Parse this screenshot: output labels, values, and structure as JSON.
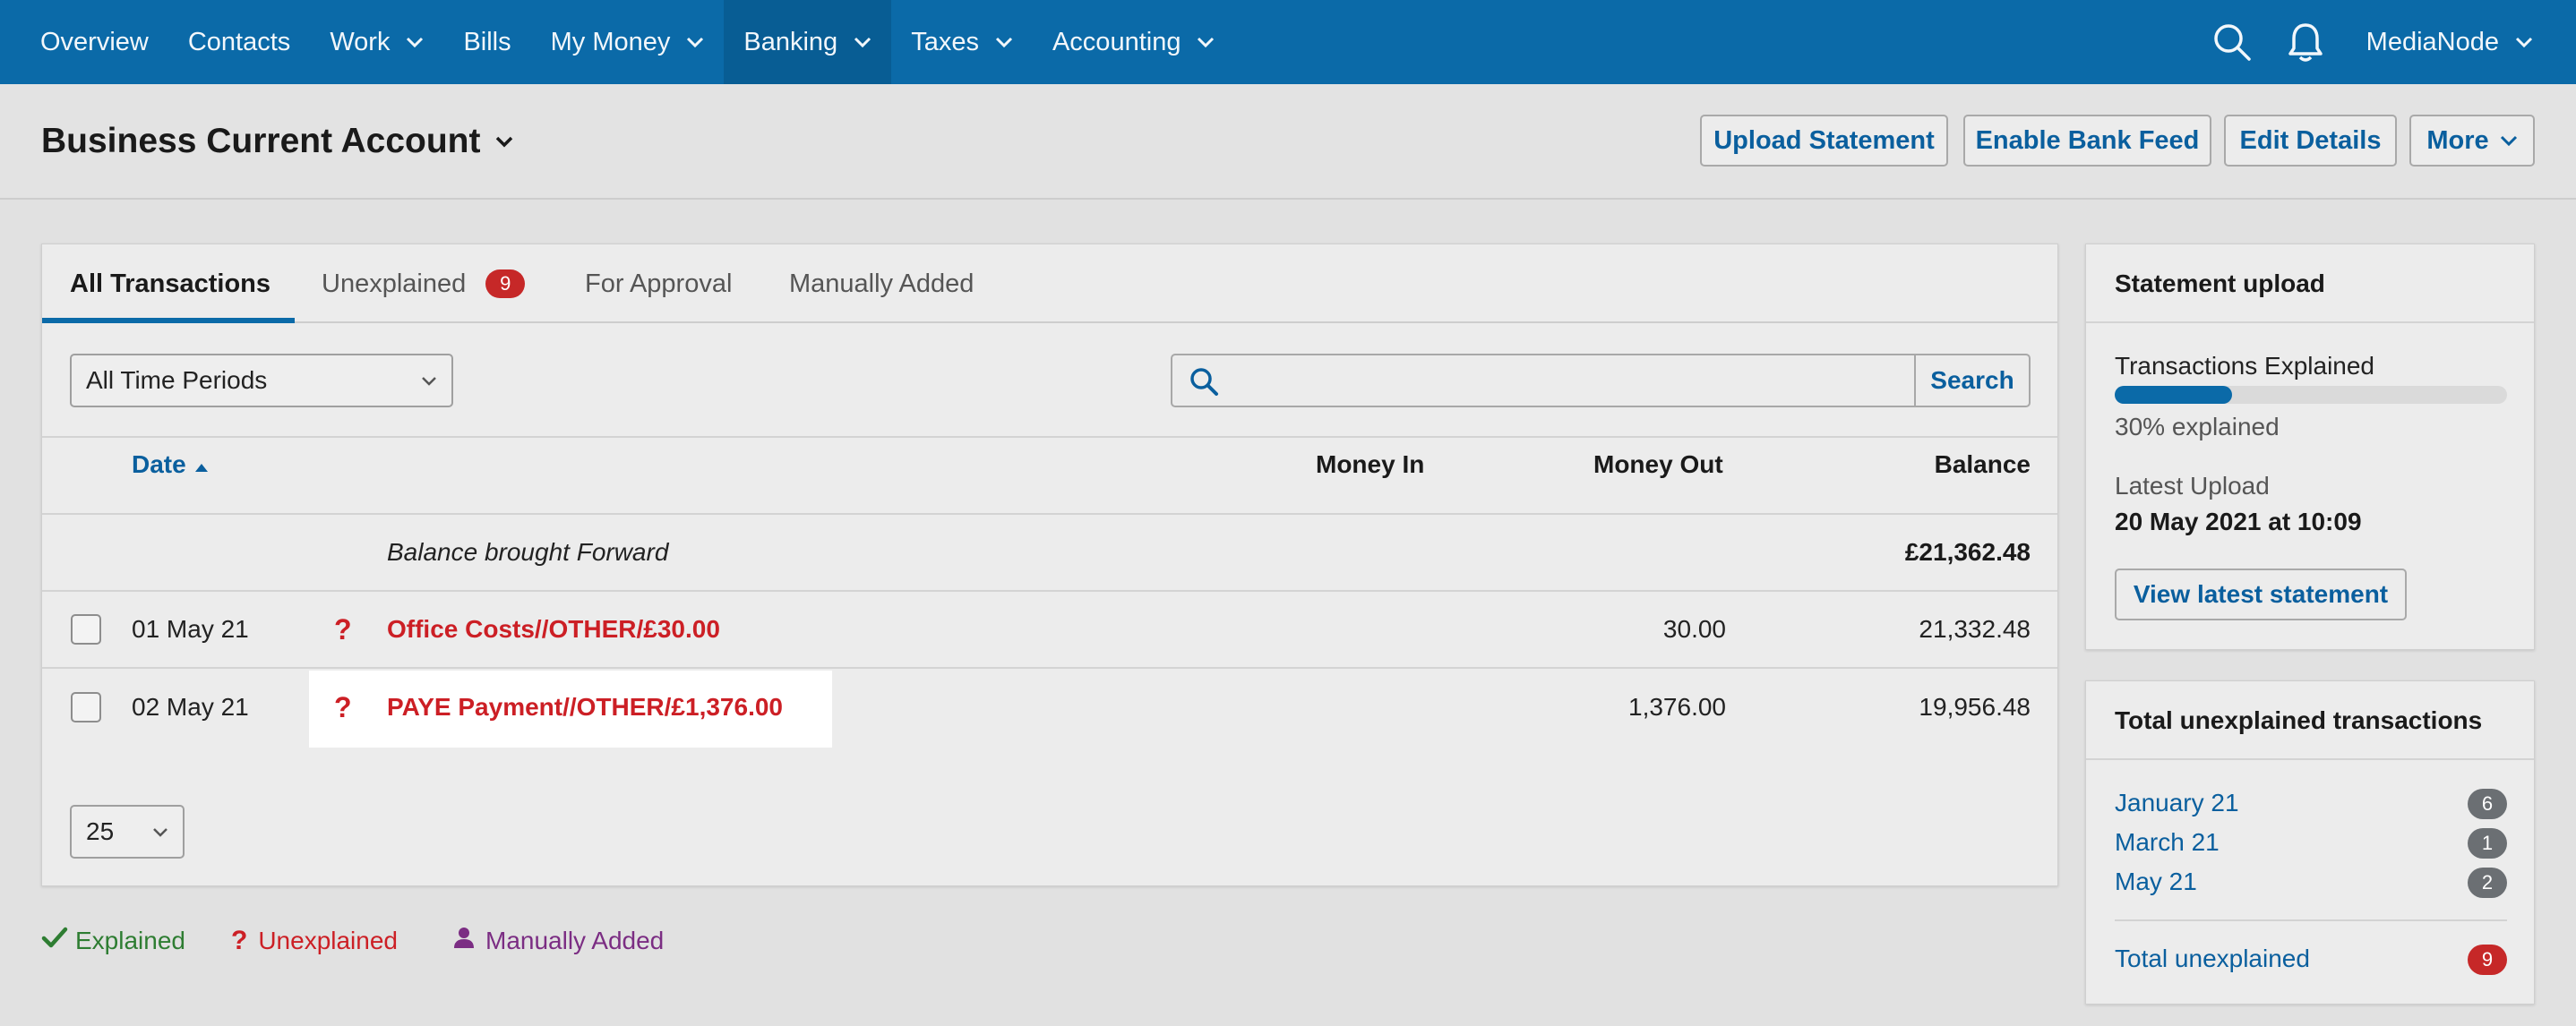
{
  "nav": {
    "items": [
      {
        "label": "Overview",
        "dropdown": false,
        "active": false
      },
      {
        "label": "Contacts",
        "dropdown": false,
        "active": false
      },
      {
        "label": "Work",
        "dropdown": true,
        "active": false
      },
      {
        "label": "Bills",
        "dropdown": false,
        "active": false
      },
      {
        "label": "My Money",
        "dropdown": true,
        "active": false
      },
      {
        "label": "Banking",
        "dropdown": true,
        "active": true
      },
      {
        "label": "Taxes",
        "dropdown": true,
        "active": false
      },
      {
        "label": "Accounting",
        "dropdown": true,
        "active": false
      }
    ],
    "user": "MediaNode",
    "icons": {
      "search": "search-icon",
      "notifications": "bell-icon"
    },
    "bg_color": "#0b6aa8",
    "active_color": "#085d94"
  },
  "header": {
    "title": "Business Current Account",
    "buttons": {
      "upload_statement": "Upload Statement",
      "enable_bank_feed": "Enable Bank Feed",
      "edit_details": "Edit Details",
      "more": "More"
    }
  },
  "tabs": {
    "all": "All Transactions",
    "unexplained": "Unexplained",
    "unexplained_count": "9",
    "for_approval": "For Approval",
    "manually_added": "Manually Added"
  },
  "filters": {
    "period": "All Time Periods",
    "search_placeholder": "",
    "search_button": "Search"
  },
  "table": {
    "headers": {
      "date": "Date",
      "money_in": "Money In",
      "money_out": "Money Out",
      "balance": "Balance"
    },
    "brought_forward": {
      "label": "Balance brought Forward",
      "balance": "£21,362.48"
    },
    "rows": [
      {
        "date": "01 May 21",
        "description": "Office Costs//OTHER/£30.00",
        "money_in": "",
        "money_out": "30.00",
        "balance": "21,332.48",
        "status": "unexplained"
      },
      {
        "date": "02 May 21",
        "description": "PAYE Payment//OTHER/£1,376.00",
        "money_in": "",
        "money_out": "1,376.00",
        "balance": "19,956.48",
        "status": "unexplained"
      }
    ],
    "page_size": "25"
  },
  "legend": {
    "explained": "Explained",
    "unexplained": "Unexplained",
    "manually_added": "Manually Added",
    "colors": {
      "explained": "#2e7d32",
      "unexplained": "#cc1f25",
      "manually_added": "#7b2d83"
    }
  },
  "statement_upload": {
    "title": "Statement upload",
    "progress_label": "Transactions Explained",
    "progress_fraction": 0.3,
    "progress_text": "30% explained",
    "latest_upload_label": "Latest Upload",
    "latest_upload_value": "20 May 2021 at 10:09",
    "view_button": "View latest statement"
  },
  "unexplained_summary": {
    "title": "Total unexplained transactions",
    "months": [
      {
        "label": "January 21",
        "count": "6"
      },
      {
        "label": "March 21",
        "count": "1"
      },
      {
        "label": "May 21",
        "count": "2"
      }
    ],
    "total_label": "Total unexplained",
    "total_count": "9",
    "colors": {
      "count_pill": "#6b6f73",
      "total_pill": "#c62828"
    }
  }
}
